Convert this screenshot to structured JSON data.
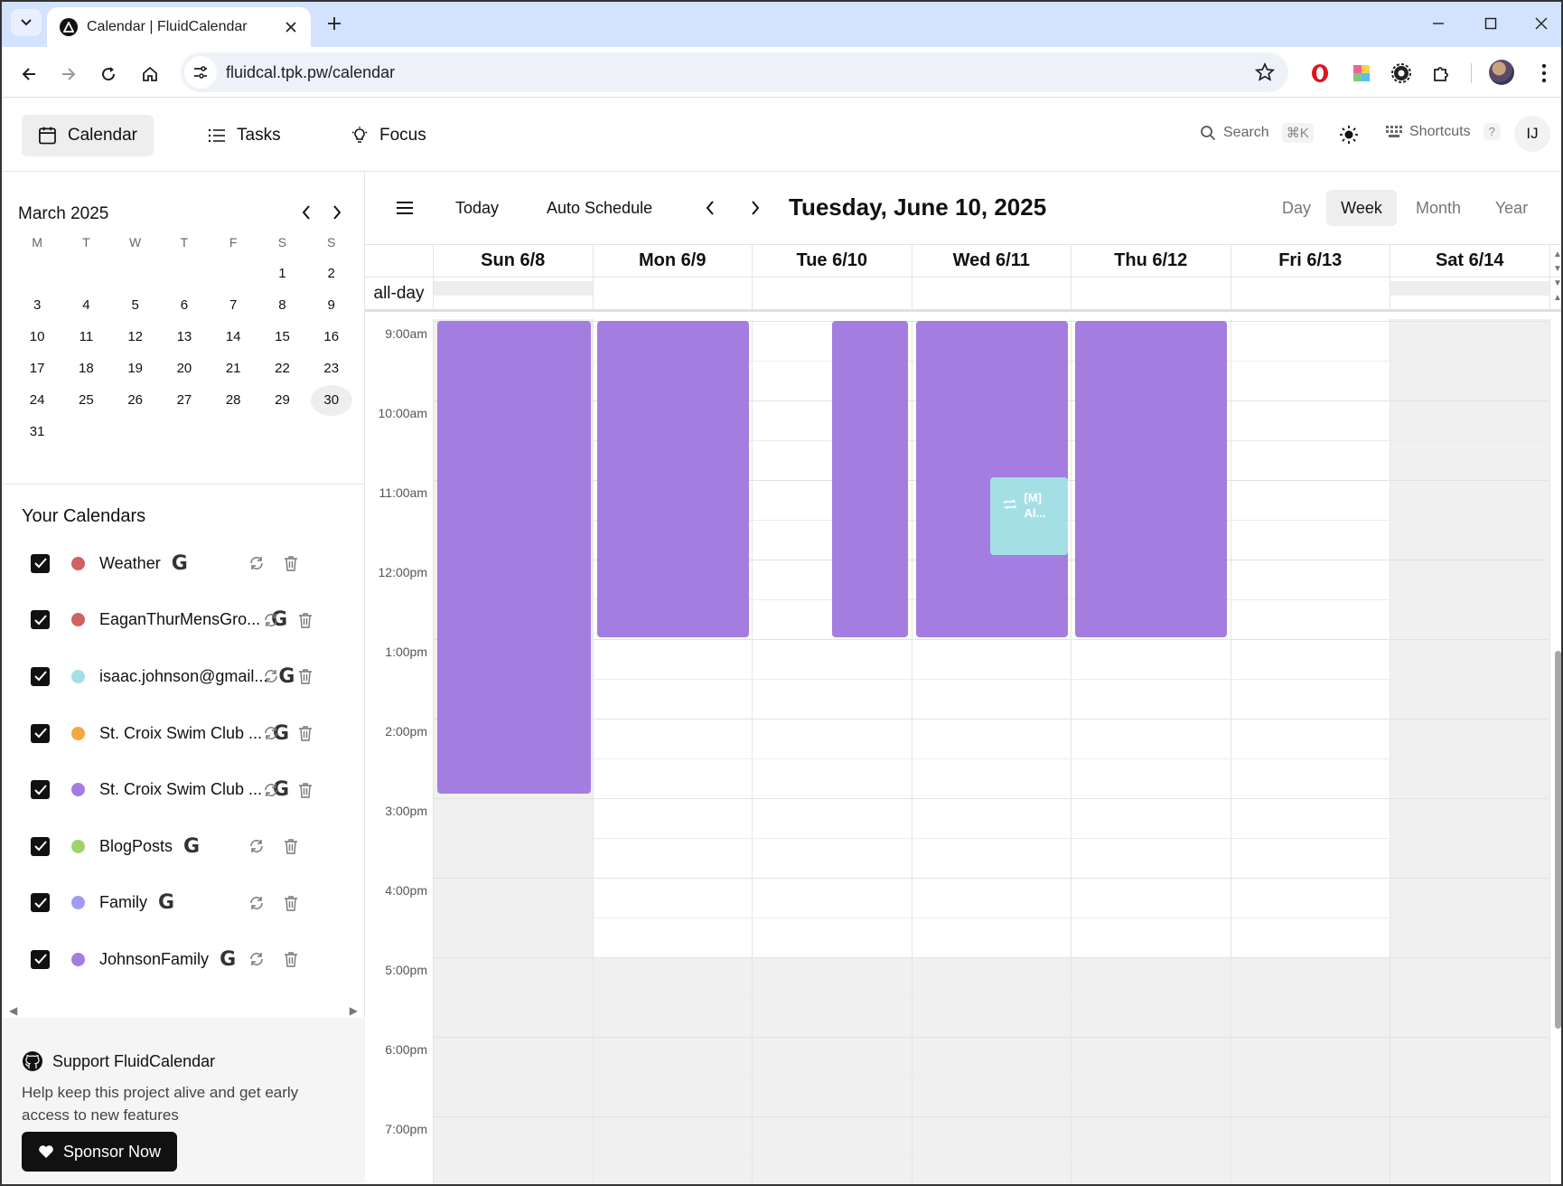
{
  "browser": {
    "tab_title": "Calendar | FluidCalendar",
    "url": "fluidcal.tpk.pw/calendar"
  },
  "header": {
    "nav": [
      {
        "label": "Calendar",
        "icon": "calendar-icon",
        "active": true
      },
      {
        "label": "Tasks",
        "icon": "list-icon",
        "active": false
      },
      {
        "label": "Focus",
        "icon": "lightbulb-icon",
        "active": false
      }
    ],
    "search_label": "Search",
    "search_shortcut": "⌘K",
    "shortcuts_label": "Shortcuts",
    "shortcuts_key": "?",
    "user_initials": "IJ"
  },
  "mini_calendar": {
    "title": "March 2025",
    "weekdays": [
      "M",
      "T",
      "W",
      "T",
      "F",
      "S",
      "S"
    ],
    "weeks": [
      [
        "",
        "",
        "",
        "",
        "",
        "1",
        "2"
      ],
      [
        "3",
        "4",
        "5",
        "6",
        "7",
        "8",
        "9"
      ],
      [
        "10",
        "11",
        "12",
        "13",
        "14",
        "15",
        "16"
      ],
      [
        "17",
        "18",
        "19",
        "20",
        "21",
        "22",
        "23"
      ],
      [
        "24",
        "25",
        "26",
        "27",
        "28",
        "29",
        "30"
      ],
      [
        "31",
        "",
        "",
        "",
        "",
        "",
        ""
      ]
    ],
    "selected_day": "30"
  },
  "calendars": {
    "title": "Your Calendars",
    "items": [
      {
        "name": "Weather",
        "color": "#d0625f",
        "checked": true
      },
      {
        "name": "EaganThurMensGro...",
        "color": "#d0625f",
        "checked": true
      },
      {
        "name": "isaac.johnson@gmail...",
        "color": "#a5dfe6",
        "checked": true
      },
      {
        "name": "St. Croix Swim Club ...",
        "color": "#f4a742",
        "checked": true
      },
      {
        "name": "St. Croix Swim Club ...",
        "color": "#a47de0",
        "checked": true
      },
      {
        "name": "BlogPosts",
        "color": "#9fd46a",
        "checked": true
      },
      {
        "name": "Family",
        "color": "#a39bf2",
        "checked": true
      },
      {
        "name": "JohnsonFamily",
        "color": "#a47de0",
        "checked": true
      }
    ]
  },
  "support": {
    "title": "Support FluidCalendar",
    "description": "Help keep this project alive and get early access to new features",
    "button": "Sponsor Now"
  },
  "toolbar": {
    "today": "Today",
    "auto_schedule": "Auto Schedule",
    "date_title": "Tuesday, June 10, 2025",
    "views": [
      "Day",
      "Week",
      "Month",
      "Year"
    ],
    "active_view": "Week"
  },
  "week": {
    "allday_label": "all-day",
    "days": [
      "Sun 6/8",
      "Mon 6/9",
      "Tue 6/10",
      "Wed 6/11",
      "Thu 6/12",
      "Fri 6/13",
      "Sat 6/14"
    ],
    "time_labels": [
      "9:00am",
      "10:00am",
      "11:00am",
      "12:00pm",
      "1:00pm",
      "2:00pm",
      "3:00pm",
      "4:00pm",
      "5:00pm",
      "6:00pm",
      "7:00pm"
    ],
    "event_color": "#a47de0",
    "teal_event": {
      "line1": "[M]",
      "line2": "Al...",
      "color": "#a5dfe6"
    }
  }
}
